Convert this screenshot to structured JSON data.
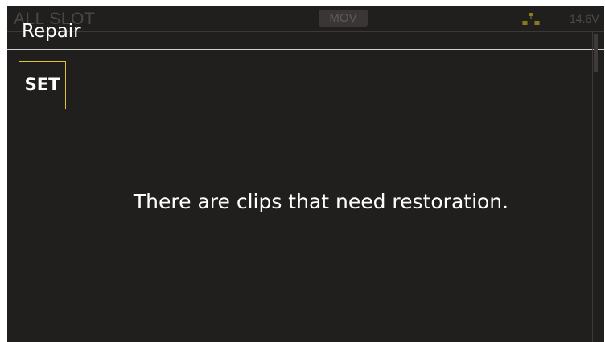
{
  "status": {
    "slot": "ALL SLOT",
    "format": "MOV",
    "network_icon": "network-icon",
    "network_color": "#8a7a1c",
    "voltage": "14.6V"
  },
  "screen": {
    "title": "Repair",
    "set_label": "SET",
    "set_border_color": "#e0c233",
    "message": "There are clips that need restoration."
  }
}
